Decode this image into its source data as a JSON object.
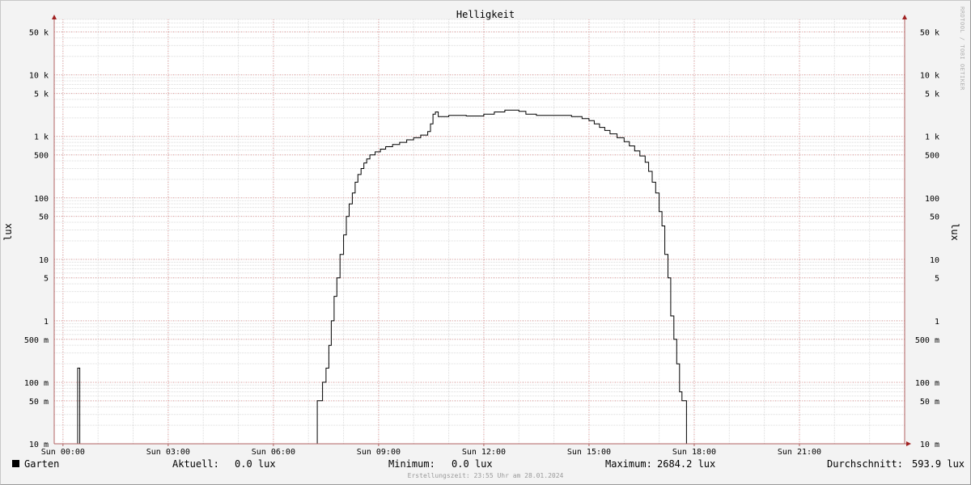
{
  "chart_data": {
    "type": "line",
    "title": "Helligkeit",
    "ylabel": "lux",
    "y_scale": "log",
    "ylim": [
      0.01,
      80000
    ],
    "xlim_hours": [
      -0.25,
      24
    ],
    "x_tick_labels": [
      "Sun 00:00",
      "Sun 03:00",
      "Sun 06:00",
      "Sun 09:00",
      "Sun 12:00",
      "Sun 15:00",
      "Sun 18:00",
      "Sun 21:00"
    ],
    "y_ticks": [
      {
        "value": 0.01,
        "label": "10 m"
      },
      {
        "value": 0.05,
        "label": "50 m"
      },
      {
        "value": 0.1,
        "label": "100 m"
      },
      {
        "value": 0.5,
        "label": "500 m"
      },
      {
        "value": 1,
        "label": "1"
      },
      {
        "value": 5,
        "label": "5"
      },
      {
        "value": 10,
        "label": "10"
      },
      {
        "value": 50,
        "label": "50"
      },
      {
        "value": 100,
        "label": "100"
      },
      {
        "value": 500,
        "label": "500"
      },
      {
        "value": 1000,
        "label": "1 k"
      },
      {
        "value": 5000,
        "label": "5 k"
      },
      {
        "value": 10000,
        "label": "10 k"
      },
      {
        "value": 50000,
        "label": "50 k"
      }
    ],
    "series": [
      {
        "name": "Garten",
        "color": "#000000",
        "points": [
          [
            -0.25,
            0
          ],
          [
            0.42,
            0
          ],
          [
            0.42,
            0.17
          ],
          [
            0.48,
            0.17
          ],
          [
            0.48,
            0
          ],
          [
            7.25,
            0
          ],
          [
            7.25,
            0.05
          ],
          [
            7.4,
            0.05
          ],
          [
            7.4,
            0.1
          ],
          [
            7.5,
            0.1
          ],
          [
            7.5,
            0.17
          ],
          [
            7.58,
            0.17
          ],
          [
            7.58,
            0.4
          ],
          [
            7.65,
            0.4
          ],
          [
            7.65,
            1.0
          ],
          [
            7.73,
            1.0
          ],
          [
            7.73,
            2.5
          ],
          [
            7.81,
            2.5
          ],
          [
            7.81,
            5
          ],
          [
            7.9,
            5
          ],
          [
            7.9,
            12
          ],
          [
            8.0,
            12
          ],
          [
            8.0,
            25
          ],
          [
            8.08,
            25
          ],
          [
            8.08,
            50
          ],
          [
            8.16,
            50
          ],
          [
            8.16,
            80
          ],
          [
            8.25,
            80
          ],
          [
            8.25,
            120
          ],
          [
            8.33,
            120
          ],
          [
            8.33,
            180
          ],
          [
            8.41,
            180
          ],
          [
            8.41,
            240
          ],
          [
            8.5,
            240
          ],
          [
            8.5,
            300
          ],
          [
            8.58,
            300
          ],
          [
            8.58,
            370
          ],
          [
            8.66,
            370
          ],
          [
            8.66,
            430
          ],
          [
            8.75,
            430
          ],
          [
            8.75,
            500
          ],
          [
            8.9,
            500
          ],
          [
            8.9,
            560
          ],
          [
            9.05,
            560
          ],
          [
            9.05,
            620
          ],
          [
            9.2,
            620
          ],
          [
            9.2,
            680
          ],
          [
            9.4,
            680
          ],
          [
            9.4,
            740
          ],
          [
            9.6,
            740
          ],
          [
            9.6,
            800
          ],
          [
            9.8,
            800
          ],
          [
            9.8,
            880
          ],
          [
            10.0,
            880
          ],
          [
            10.0,
            950
          ],
          [
            10.2,
            950
          ],
          [
            10.2,
            1050
          ],
          [
            10.4,
            1050
          ],
          [
            10.4,
            1200
          ],
          [
            10.48,
            1200
          ],
          [
            10.48,
            1600
          ],
          [
            10.55,
            1600
          ],
          [
            10.55,
            2300
          ],
          [
            10.62,
            2300
          ],
          [
            10.62,
            2500
          ],
          [
            10.7,
            2500
          ],
          [
            10.7,
            2100
          ],
          [
            11.0,
            2100
          ],
          [
            11.0,
            2200
          ],
          [
            11.5,
            2200
          ],
          [
            11.5,
            2150
          ],
          [
            12.0,
            2150
          ],
          [
            12.0,
            2300
          ],
          [
            12.3,
            2300
          ],
          [
            12.3,
            2500
          ],
          [
            12.6,
            2500
          ],
          [
            12.6,
            2680
          ],
          [
            13.0,
            2680
          ],
          [
            13.0,
            2550
          ],
          [
            13.2,
            2550
          ],
          [
            13.2,
            2300
          ],
          [
            13.5,
            2300
          ],
          [
            13.5,
            2200
          ],
          [
            14.5,
            2200
          ],
          [
            14.5,
            2100
          ],
          [
            14.8,
            2100
          ],
          [
            14.8,
            1950
          ],
          [
            15.0,
            1950
          ],
          [
            15.0,
            1800
          ],
          [
            15.15,
            1800
          ],
          [
            15.15,
            1600
          ],
          [
            15.3,
            1600
          ],
          [
            15.3,
            1400
          ],
          [
            15.45,
            1400
          ],
          [
            15.45,
            1250
          ],
          [
            15.6,
            1250
          ],
          [
            15.6,
            1100
          ],
          [
            15.8,
            1100
          ],
          [
            15.8,
            950
          ],
          [
            16.0,
            950
          ],
          [
            16.0,
            820
          ],
          [
            16.15,
            820
          ],
          [
            16.15,
            700
          ],
          [
            16.3,
            700
          ],
          [
            16.3,
            580
          ],
          [
            16.45,
            580
          ],
          [
            16.45,
            480
          ],
          [
            16.6,
            480
          ],
          [
            16.6,
            380
          ],
          [
            16.7,
            380
          ],
          [
            16.7,
            270
          ],
          [
            16.8,
            270
          ],
          [
            16.8,
            180
          ],
          [
            16.9,
            180
          ],
          [
            16.9,
            120
          ],
          [
            17.0,
            120
          ],
          [
            17.0,
            60
          ],
          [
            17.08,
            60
          ],
          [
            17.08,
            35
          ],
          [
            17.16,
            35
          ],
          [
            17.16,
            12
          ],
          [
            17.25,
            12
          ],
          [
            17.25,
            5
          ],
          [
            17.33,
            5
          ],
          [
            17.33,
            1.2
          ],
          [
            17.42,
            1.2
          ],
          [
            17.42,
            0.5
          ],
          [
            17.5,
            0.5
          ],
          [
            17.5,
            0.2
          ],
          [
            17.58,
            0.2
          ],
          [
            17.58,
            0.07
          ],
          [
            17.65,
            0.07
          ],
          [
            17.65,
            0.05
          ],
          [
            17.78,
            0.05
          ],
          [
            17.78,
            0
          ],
          [
            24,
            0
          ]
        ]
      }
    ],
    "grid": true
  },
  "watermark": "RRDTOOL / TOBI OETIKER",
  "legend": {
    "series_name": "Garten",
    "current_label": "Aktuell:",
    "current_value": "0.0 lux",
    "min_label": "Minimum:",
    "min_value": "0.0 lux",
    "max_label": "Maximum:",
    "max_value": "2684.2 lux",
    "avg_label": "Durchschnitt:",
    "avg_value": "593.9 lux"
  },
  "creation_time": "Erstellungszeit: 23:55 Uhr am 28.01.2024"
}
